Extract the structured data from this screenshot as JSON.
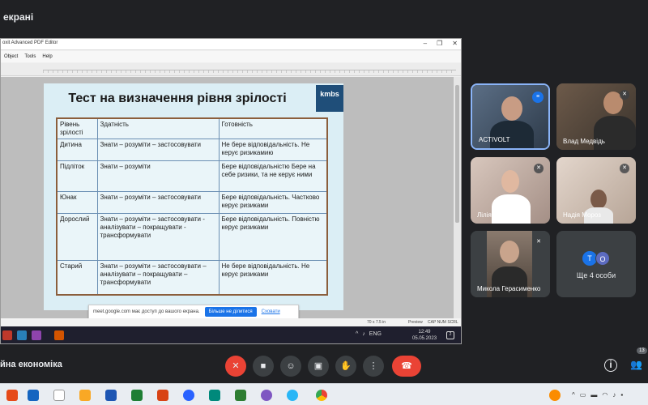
{
  "top": {
    "title": "екрані"
  },
  "window": {
    "title": "oxit Advanced PDF Editor",
    "controls": [
      "–",
      "❐",
      "✕"
    ],
    "menu": [
      "Object",
      "Tools",
      "Help"
    ]
  },
  "slide": {
    "title": "Тест на визначення рівня зрілості",
    "logo_text": "kmbs",
    "headers": [
      "Рівень зрілості",
      "Здатність",
      "Готовність"
    ],
    "rows": [
      [
        "Дитина",
        "Знати – розуміти – застосовувати",
        "Не бере відповідальність. Не керує ризикамию"
      ],
      [
        "Підліток",
        "Знати – розуміти",
        "Бере відповідальністю Бере на себе ризики, та не керує ними"
      ],
      [
        "Юнак",
        "Знати – розуміти – застосовувати",
        "Бере відповідальність. Частково керує ризиками"
      ],
      [
        "Дорослий",
        "Знати – розуміти – застосовувати - аналізувати – покращувати - трансформувати",
        "Бере відповідальність. Повністю керує ризиками"
      ],
      [
        "Старий",
        "Знати – розуміти – застосовувати – аналізувати – покращувати – трансформувати",
        "Не бере відповідальність. Не керує ризиками"
      ]
    ]
  },
  "share_banner": {
    "text": "meet.google.com має доступ до вашого екрана.",
    "stop_label": "Більше не ділитися",
    "hide_label": "Сховати"
  },
  "pdf_status": {
    "size": "70 x 7.5 in",
    "mode": "Preview",
    "keys": "CAP NUM SCRL"
  },
  "inner_taskbar": {
    "lang": "ENG",
    "time": "12:49",
    "date": "05.05.2023",
    "notif": "2"
  },
  "participants": [
    {
      "name": "ACTIVOLT"
    },
    {
      "name": "Влад Медвідь"
    },
    {
      "name": "Лілія Мариневич"
    },
    {
      "name": "Надія Мороз"
    },
    {
      "name": "Микола Герасименко"
    }
  ],
  "more": {
    "initials": [
      "Т",
      "О"
    ],
    "label": "Ще 4 особи"
  },
  "meeting": {
    "name": "йна економіка",
    "people_count": "13"
  },
  "colors": {
    "meet_bg": "#202124",
    "end_call": "#ea4335",
    "accent": "#1a73e8"
  }
}
